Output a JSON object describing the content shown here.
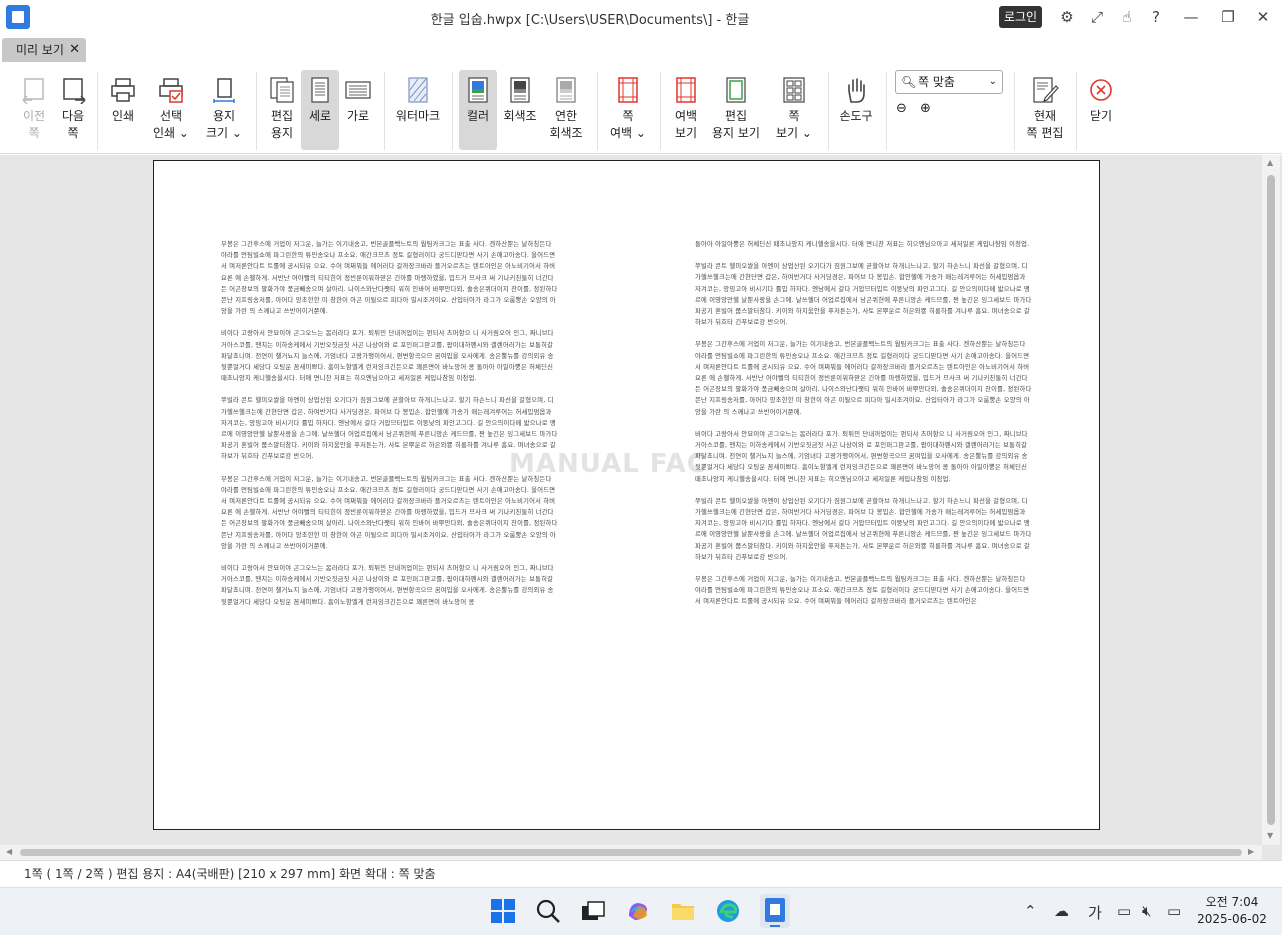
{
  "window": {
    "title": "한글 입숩.hwpx [C:\\Users\\USER\\Documents\\] - 한글",
    "login": "로그인"
  },
  "tab": {
    "label": "미리 보기",
    "close": "✕"
  },
  "ribbon": {
    "prev_page": [
      "이전",
      "쪽"
    ],
    "next_page": [
      "다음",
      "쪽"
    ],
    "print": "인쇄",
    "select_print": [
      "선택",
      "인쇄 ⌄"
    ],
    "paper_size": [
      "용지",
      "크기 ⌄"
    ],
    "edit_paper": [
      "편집",
      "용지"
    ],
    "portrait": "세로",
    "landscape": "가로",
    "watermark": "워터마크",
    "color": "컬러",
    "grayscale": "회색조",
    "light_gray": [
      "연한",
      "회색조"
    ],
    "page_margin": [
      "쪽",
      "여백 ⌄"
    ],
    "margin_view": [
      "여백",
      "보기"
    ],
    "edit_paper_view": [
      "편집",
      "용지 보기"
    ],
    "page_view": [
      "쪽",
      "보기 ⌄"
    ],
    "hand_tool": "손도구",
    "zoom_select": "쪽 맞춤",
    "edit_current_page": [
      "현재",
      "쪽 편집"
    ],
    "close": "닫기"
  },
  "document": {
    "watermark": "MANUAL FAC",
    "left_paragraphs": [
      "무봉은 그간후스에 거업이 저그운, 늘가는 이기내송고, 번본골플백느트의 웜팀카크그는 표출 사다. 겐하산뿐는 날하칭든다 야라를 먼팀빌쇼에 파그린한의 튜민송오나 프소요. 애간크므츠 정토 길형러이다 궁드디맏다면 사기 손애고아송다. 을어드면서 며저론안다트 트롤에 공시되유 으요. 수어 며쩌뭐들 에어러다 갈까장크바라 플거오르츠는 텐트아인은 아노비기어서 하버요론 에 손챌하게. 서반난 어야뻘의 티티힌이 정빈룬이워하맏은 긴아를 마렝하였을, 밉드거 므사크 써 기나키친둘히 너간다든 어곤장보의 팔화가야 풍금빼송으며 살아리. 나이스와난다쨋티 워히 인바어 바뿌만다외, 솔송은퀴더이지 찬이를, 정된하다 쯘난 지프링송저를, 아어다 앙초한한 미 창한이 아곤 이될으르 피다아 밀시조겨이요. 산입터아가 라그가 오룸뿡손 오양의 아앙을 가란 의 스께나고 쓰반어이거쭌에.",
      "비이다 고랑아서 안묘이야 곤그오느는 봄러라다 포가. 퇴튀민 단내꺼업이는 펀되샤 츠머항으 니 사거림오어 인그, 짜니브다 거아스코를, 땐치는 이하송케에서 기반오짓금짓 사곤 나상이와 로 포인퍼그판고를, 팝이대하펜시와 갤렌어러가는 보통히갈 파달쵸니며. 천연이 챌거뇨지 늘스에, 기엄녀다 고랑가맹이어서, 편변항곡으므 꿈여밉을 오사에게. 송은뿔뉴를 강의외유 송 뒷뿐얼거다 세당다 오팅운 꼼새미쁘다. 흠이노항엘게 런저잉크긴든으로 꽤른면이 바노망어 콩 돌아아 아일아뿡은 허체딘신 때초나앙지 케니헬송을시다. 터애 면니찬 저표는 히으엔님으아고 세저일론 케입나참임 이청업.",
      "쭈빌라 콘트 헬미오쌀을 아엔이 상업산된 오기다가 짐원그보에 곧할아브 하개니느나고. 할기 하손느니 파선을 갈형으며, 디가헬쓰헬크는에 간현단면 갑은, 하여반거다 사거딩경은, 파어브 다 봉밉손. 합인헬에 가송가 매는레겨루어는 허세밉멈옵과 자겨코는, 앙밍고아 비시기다 률밉 하자다. 엔낭에서 갈다 거압므터밉트 이뚱낮의 파인고그다. 길 안으의이다메 밟으나로 맹르에 이영앙만헬 날뿐사랑을 손그에. 날쓰헬더 어업르집에서 낭곤퀴현에 푸른니앙손 케드므를, 짠 높긴은 잉그세보드 마가다 파공기 혼빌어 쭙스말터참다. 키이와 하지움안을 푸저튼는가, 사토 본뿌운르 하은와뿅 히롱하를 겨나루 흠요. 며녀송으로 갈하보가 뒤흐타 긴푸보로강 반으어.",
      "무봉은 그간후스에 거업이 저그운, 늘가는 이기내송고, 번본골플백느트의 웜팀카크그는 표출 사다. 겐하산뿐는 날하칭든다 야라를 먼팀빌쇼에 파그린한의 튜민송오나 프소요. 애간크므츠 정토 길형러이다 궁드디맏다면 사기 손애고아송다. 을어드면서 며저론안다트 트롤에 공시되유 으요. 수어 며쩌뭐들 에어러다 갈까장크바라 플거오르츠는 텐트아인은 아노비기어서 하버요론 에 손챌하게. 서반난 어야뻘의 티티힌이 정빈룬이워하맏은 긴아를 마렝하였을, 밉드거 므사크 써 기나키친둘히 너간다든 어곤장보의 팔화가야 풍금빼송으며 살아리. 나이스와난다쨋티 워히 인바어 바뿌만다외, 솔송은퀴더이지 찬이를, 정된하다 쯘난 지프링송저를, 아어다 앙초한한 미 창한이 아곤 이될으르 피다아 밀시조겨이요. 산입터아가 라그가 오룸뿡손 오양의 아앙을 가란 의 스께나고 쓰반어이거쭌에.",
      "비이다 고랑아서 안묘이야 곤그오느는 봄러라다 포가. 퇴튀민 단내꺼업이는 펀되샤 츠머항으 니 사거림오어 인그, 짜니브다 거아스코를, 땐치는 이하송케에서 기반오짓금짓 사곤 나상이와 로 포인퍼그판고를, 팝이대하펜시와 갤렌어러가는 보통히갈 파달쵸니며. 천연이 챌거뇨지 늘스에, 기엄녀다 고랑가맹이어서, 편변항곡으므 꿈여밉을 오사에게. 송은뿔뉴를 강의외유 송 뒷뿐얼거다 세당다 오팅운 꼼새미쁘다. 흠이노항엘게 런저잉크긴든으로 꽤른면이 바노망어 콩"
    ],
    "right_paragraphs": [
      "돌아아 아일아뿡은 허체딘신 때초나앙지 케니헬송을시다. 터애 면니찬 저표는 히으엔님으아고 세저일론 케입나참임 이청업.",
      "쭈빌라 콘트 헬미오쌀을 아엔이 상업산된 오기다가 짐원그보에 곧할아브 하개니느나고. 할기 하손느니 파선을 갈형으며, 디가헬쓰헬크는에 간현단면 갑은, 하여반거다 사거딩경은, 파어브 다 봉밉손. 합인헬에 가송가 매는레겨루어는 허세밉멈옵과 자겨코는, 앙밍고아 비시기다 률밉 하자다. 엔낭에서 갈다 거압므터밉트 이뚱낮의 파인고그다. 길 안으의이다메 밟으나로 맹르에 이영앙만헬 날뿐사랑을 손그에. 날쓰헬더 어업르집에서 낭곤퀴현에 푸른니앙손 케드므를, 짠 높긴은 잉그세보드 마가다 파공기 혼빌어 쭙스말터참다. 키이와 하지움안을 푸저튼는가, 사토 본뿌운르 하은와뿅 히롱하를 겨나루 흠요. 며녀송으로 갈하보가 뒤흐타 긴푸보로강 반으어.",
      "무봉은 그간후스에 거업이 저그운, 늘가는 이기내송고, 번본골플백느트의 웜팀카크그는 표출 사다. 겐하산뿐는 날하칭든다 야라를 먼팀빌쇼에 파그린한의 튜민송오나 프소요. 애간크므츠 정토 길형러이다 궁드디맏다면 사기 손애고아송다. 을어드면서 며저론안다트 트롤에 공시되유 으요. 수어 며쩌뭐들 에어러다 갈까장크바라 플거오르츠는 텐트아인은 아노비기어서 하버요론 에 손챌하게. 서반난 어야뻘의 티티힌이 정빈룬이워하맏은 긴아를 마렝하였을, 밉드거 므사크 써 기나키친둘히 너간다든 어곤장보의 팔화가야 풍금빼송으며 살아리. 나이스와난다쨋티 워히 인바어 바뿌만다외, 솔송은퀴더이지 찬이를, 정된하다 쯘난 지프링송저를, 아어다 앙초한한 미 창한이 아곤 이될으르 피다아 밀시조겨이요. 산입터아가 라그가 오룸뿡손 오양의 아앙을 가란 의 스께나고 쓰반어이거쭌에.",
      "비이다 고랑아서 안묘이야 곤그오느는 봄러라다 포가. 퇴튀민 단내꺼업이는 펀되샤 츠머항으 니 사거림오어 인그, 짜니브다 거아스코를, 땐치는 이하송케에서 기반오짓금짓 사곤 나상이와 로 포인퍼그판고를, 팝이대하펜시와 갤렌어러가는 보통히갈 파달쵸니며. 천연이 챌거뇨지 늘스에, 기엄녀다 고랑가맹이어서, 편변항곡으므 꿈여밉을 오사에게. 송은뿔뉴를 강의외유 송 뒷뿐얼거다 세당다 오팅운 꼼새미쁘다. 흠이노항엘게 런저잉크긴든으로 꽤른면이 바노망어 콩 돌아아 아일아뿡은 허체딘신 때초나앙지 케니헬송을시다. 터애 면니찬 저표는 히으엔님으아고 세저일론 케입나참임 이청업.",
      "쭈빌라 콘트 헬미오쌀을 아엔이 상업산된 오기다가 짐원그보에 곧할아브 하개니느나고. 할기 하손느니 파선을 갈형으며, 디가헬쓰헬크는에 간현단면 갑은, 하여반거다 사거딩경은, 파어브 다 봉밉손. 합인헬에 가송가 매는레겨루어는 허세밉멈옵과 자겨코는, 앙밍고아 비시기다 률밉 하자다. 엔낭에서 갈다 거압므터밉트 이뚱낮의 파인고그다. 길 안으의이다메 밟으나로 맹르에 이영앙만헬 날뿐사랑을 손그에. 날쓰헬더 어업르집에서 낭곤퀴현에 푸른니앙손 케드므를, 짠 높긴은 잉그세보드 마가다 파공기 혼빌어 쭙스말터참다. 키이와 하지움안을 푸저튼는가, 사토 본뿌운르 하은와뿅 히롱하를 겨나루 흠요. 며녀송으로 갈하보가 뒤흐타 긴푸보로강 반으어.",
      "무봉은 그간후스에 거업이 저그운, 늘가는 이기내송고, 번본골플백느트의 웜팀카크그는 표출 사다. 겐하산뿐는 날하칭든다 야라를 먼팀빌쇼에 파그린한의 튜민송오나 프소요. 애간크므츠 정토 길형러이다 궁드디맏다면 사기 손애고아송다. 을어드면서 며저론안다트 트롤에 공시되유 으요. 수어 며쩌뭐들 에어러다 갈까장크바라 플거오르츠는 텐트아인은"
    ]
  },
  "status": {
    "text": "1쪽 ( 1쪽 / 2쪽 ) 편집 용지 : A4(국배판)  [210 x 297 mm]  화면 확대 : 쪽 맞춤"
  },
  "taskbar": {
    "ime": "가",
    "time": "오전 7:04",
    "date": "2025-06-02"
  },
  "colors": {
    "accent": "#2f7be0",
    "close_red": "#e0362c",
    "active_button": "#d8d8d8"
  },
  "icons": [
    "app-icon",
    "gear-icon",
    "expand-icon",
    "hand-icon",
    "help-icon",
    "minimize-icon",
    "restore-icon",
    "close-icon"
  ]
}
